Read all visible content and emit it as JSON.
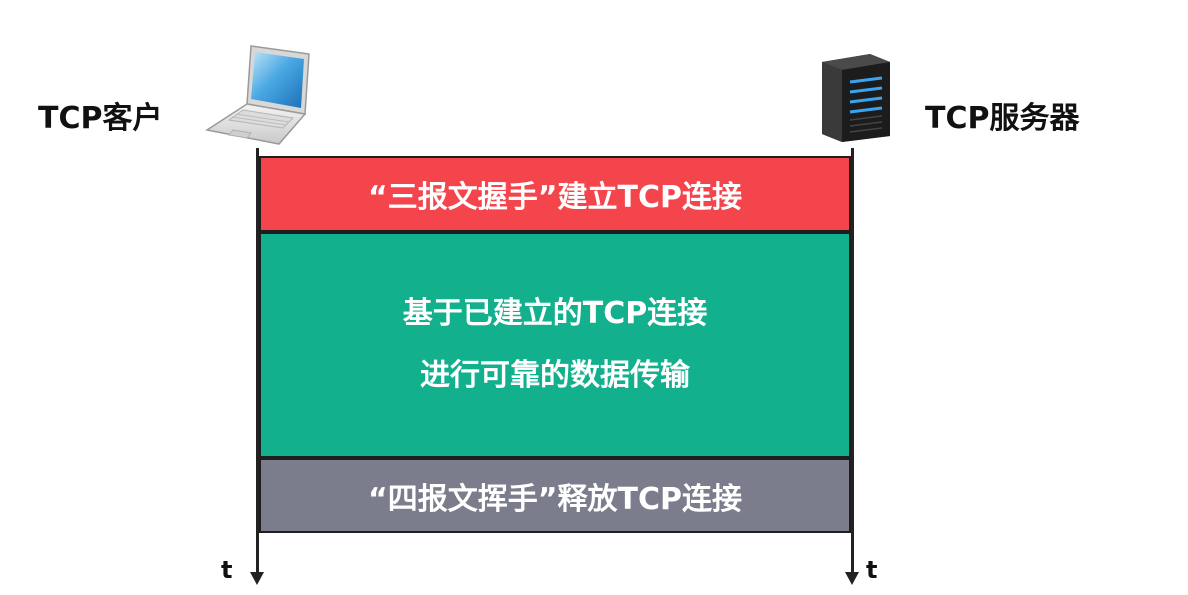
{
  "client": {
    "label": "TCP客户"
  },
  "server": {
    "label": "TCP服务器"
  },
  "timeline": {
    "client_t": "t",
    "server_t": "t"
  },
  "phases": {
    "handshake": {
      "text": "“三报文握手”建立TCP连接",
      "color": "#f4454c"
    },
    "transfer": {
      "line1": "基于已建立的TCP连接",
      "line2": "进行可靠的数据传输",
      "color": "#13b08d"
    },
    "teardown": {
      "text": "“四报文挥手”释放TCP连接",
      "color": "#7b7d8d"
    }
  },
  "icons": {
    "client": "laptop-icon",
    "server": "server-tower-icon"
  }
}
